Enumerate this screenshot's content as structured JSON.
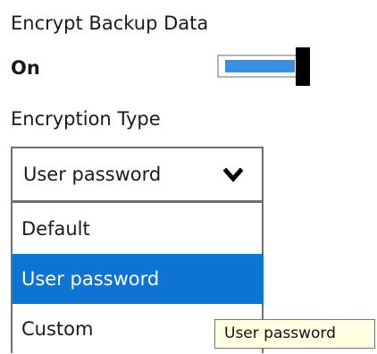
{
  "encrypt_backup": {
    "title": "Encrypt Backup Data",
    "state_label": "On",
    "toggle_on": true,
    "accent_color": "#3b8fe0"
  },
  "encryption_type": {
    "title": "Encryption Type",
    "selected_value": "User password",
    "dropdown_icon": "chevron-down-icon",
    "options": [
      {
        "label": "Default",
        "selected": false
      },
      {
        "label": "User password",
        "selected": true
      },
      {
        "label": "Custom",
        "selected": false
      }
    ],
    "selection_color": "#0b74d4"
  },
  "tooltip": {
    "text": "User password",
    "background": "#ffffe1"
  }
}
